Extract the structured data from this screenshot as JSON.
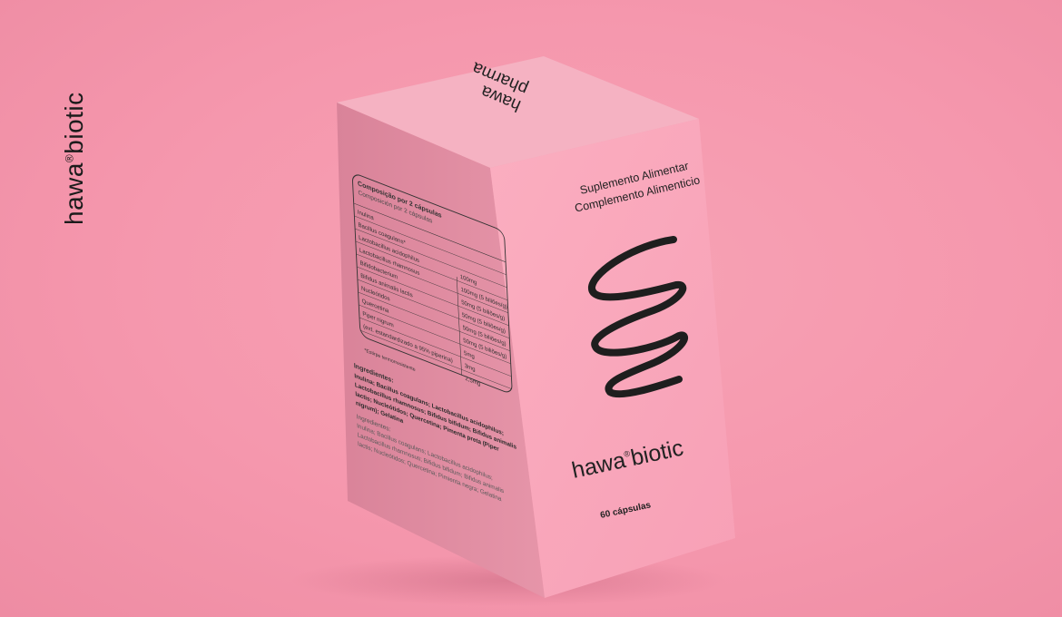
{
  "brand": {
    "name_part1": "hawa",
    "name_mark": "®",
    "name_part2": "biotic"
  },
  "box": {
    "top_logo_line1": "hawa",
    "top_logo_line2": "pharma",
    "front": {
      "subtitle_pt": "Suplemento Alimentar",
      "subtitle_es": "Complemento Alimenticio",
      "logo_part1": "hawa",
      "logo_mark": "®",
      "logo_part2": "biotic",
      "count": "60 cápsulas"
    },
    "side": {
      "table_title": "Composição por 2 cápsulas",
      "table_title_es": "Composición por 2 cápsulas",
      "rows": [
        {
          "name": "Inulina",
          "value": ""
        },
        {
          "name": "Bacillus coagulans*",
          "value": "100mg"
        },
        {
          "name": "Lactobacillus acidophilus",
          "value": "100mg (5 biliões/g)"
        },
        {
          "name": "Lactobacillus rhamnosus",
          "value": "50mg (5 biliões/g)"
        },
        {
          "name": "Bifidobacterium",
          "value": "50mg (5 biliões/g)"
        },
        {
          "name": "Bifidus animalis lactis",
          "value": "50mg (5 biliões/g)"
        },
        {
          "name": "Nucleótidos",
          "value": "50mg (5 biliões/g)"
        },
        {
          "name": "Quercetina",
          "value": "5mg"
        },
        {
          "name": "Piper nigrum",
          "value": "3mg"
        },
        {
          "name": "(ext. estandardizado a 95% piperina)",
          "value": "2,5mg"
        }
      ],
      "footnote": "*Estirpe termorresistente",
      "ingredients_title": "Ingredientes:",
      "ingredients_lines": [
        "Inulina; Bacillus coagulans; Lactobacillus acidophilus;",
        "Lactobacillus rhamnosus; Bifidus bifidum; Bifidus animalis",
        "lactis; Nucleótidos; Quercetina; Pimenta preta (Piper",
        "nigrum); Gelatina"
      ],
      "ingredients_es_title": "Ingredientes:",
      "ingredients_es_lines": [
        "Inulina; Bacillus coagulans; Lactobacillus acidophilus;",
        "Lactobacillus rhamnosus; Bifidus bifidum; Bifidus animalis",
        "lactis; Nucleótidos; Quercetina; Pimienta negra; Gelatina"
      ]
    }
  },
  "colors": {
    "background": "#f597ad",
    "box_front": "#f9a6ba",
    "box_side": "#df899e",
    "box_top": "#f4b3c3",
    "ink": "#222222"
  }
}
